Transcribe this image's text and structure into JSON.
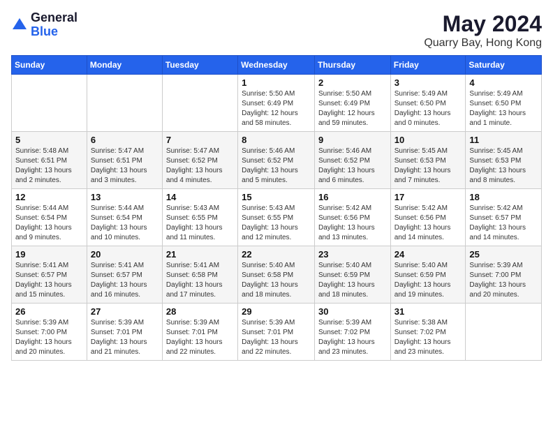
{
  "logo": {
    "general": "General",
    "blue": "Blue"
  },
  "title": "May 2024",
  "subtitle": "Quarry Bay, Hong Kong",
  "days_of_week": [
    "Sunday",
    "Monday",
    "Tuesday",
    "Wednesday",
    "Thursday",
    "Friday",
    "Saturday"
  ],
  "weeks": [
    [
      {
        "day": "",
        "info": ""
      },
      {
        "day": "",
        "info": ""
      },
      {
        "day": "",
        "info": ""
      },
      {
        "day": "1",
        "info": "Sunrise: 5:50 AM\nSunset: 6:49 PM\nDaylight: 12 hours\nand 58 minutes."
      },
      {
        "day": "2",
        "info": "Sunrise: 5:50 AM\nSunset: 6:49 PM\nDaylight: 12 hours\nand 59 minutes."
      },
      {
        "day": "3",
        "info": "Sunrise: 5:49 AM\nSunset: 6:50 PM\nDaylight: 13 hours\nand 0 minutes."
      },
      {
        "day": "4",
        "info": "Sunrise: 5:49 AM\nSunset: 6:50 PM\nDaylight: 13 hours\nand 1 minute."
      }
    ],
    [
      {
        "day": "5",
        "info": "Sunrise: 5:48 AM\nSunset: 6:51 PM\nDaylight: 13 hours\nand 2 minutes."
      },
      {
        "day": "6",
        "info": "Sunrise: 5:47 AM\nSunset: 6:51 PM\nDaylight: 13 hours\nand 3 minutes."
      },
      {
        "day": "7",
        "info": "Sunrise: 5:47 AM\nSunset: 6:52 PM\nDaylight: 13 hours\nand 4 minutes."
      },
      {
        "day": "8",
        "info": "Sunrise: 5:46 AM\nSunset: 6:52 PM\nDaylight: 13 hours\nand 5 minutes."
      },
      {
        "day": "9",
        "info": "Sunrise: 5:46 AM\nSunset: 6:52 PM\nDaylight: 13 hours\nand 6 minutes."
      },
      {
        "day": "10",
        "info": "Sunrise: 5:45 AM\nSunset: 6:53 PM\nDaylight: 13 hours\nand 7 minutes."
      },
      {
        "day": "11",
        "info": "Sunrise: 5:45 AM\nSunset: 6:53 PM\nDaylight: 13 hours\nand 8 minutes."
      }
    ],
    [
      {
        "day": "12",
        "info": "Sunrise: 5:44 AM\nSunset: 6:54 PM\nDaylight: 13 hours\nand 9 minutes."
      },
      {
        "day": "13",
        "info": "Sunrise: 5:44 AM\nSunset: 6:54 PM\nDaylight: 13 hours\nand 10 minutes."
      },
      {
        "day": "14",
        "info": "Sunrise: 5:43 AM\nSunset: 6:55 PM\nDaylight: 13 hours\nand 11 minutes."
      },
      {
        "day": "15",
        "info": "Sunrise: 5:43 AM\nSunset: 6:55 PM\nDaylight: 13 hours\nand 12 minutes."
      },
      {
        "day": "16",
        "info": "Sunrise: 5:42 AM\nSunset: 6:56 PM\nDaylight: 13 hours\nand 13 minutes."
      },
      {
        "day": "17",
        "info": "Sunrise: 5:42 AM\nSunset: 6:56 PM\nDaylight: 13 hours\nand 14 minutes."
      },
      {
        "day": "18",
        "info": "Sunrise: 5:42 AM\nSunset: 6:57 PM\nDaylight: 13 hours\nand 14 minutes."
      }
    ],
    [
      {
        "day": "19",
        "info": "Sunrise: 5:41 AM\nSunset: 6:57 PM\nDaylight: 13 hours\nand 15 minutes."
      },
      {
        "day": "20",
        "info": "Sunrise: 5:41 AM\nSunset: 6:57 PM\nDaylight: 13 hours\nand 16 minutes."
      },
      {
        "day": "21",
        "info": "Sunrise: 5:41 AM\nSunset: 6:58 PM\nDaylight: 13 hours\nand 17 minutes."
      },
      {
        "day": "22",
        "info": "Sunrise: 5:40 AM\nSunset: 6:58 PM\nDaylight: 13 hours\nand 18 minutes."
      },
      {
        "day": "23",
        "info": "Sunrise: 5:40 AM\nSunset: 6:59 PM\nDaylight: 13 hours\nand 18 minutes."
      },
      {
        "day": "24",
        "info": "Sunrise: 5:40 AM\nSunset: 6:59 PM\nDaylight: 13 hours\nand 19 minutes."
      },
      {
        "day": "25",
        "info": "Sunrise: 5:39 AM\nSunset: 7:00 PM\nDaylight: 13 hours\nand 20 minutes."
      }
    ],
    [
      {
        "day": "26",
        "info": "Sunrise: 5:39 AM\nSunset: 7:00 PM\nDaylight: 13 hours\nand 20 minutes."
      },
      {
        "day": "27",
        "info": "Sunrise: 5:39 AM\nSunset: 7:01 PM\nDaylight: 13 hours\nand 21 minutes."
      },
      {
        "day": "28",
        "info": "Sunrise: 5:39 AM\nSunset: 7:01 PM\nDaylight: 13 hours\nand 22 minutes."
      },
      {
        "day": "29",
        "info": "Sunrise: 5:39 AM\nSunset: 7:01 PM\nDaylight: 13 hours\nand 22 minutes."
      },
      {
        "day": "30",
        "info": "Sunrise: 5:39 AM\nSunset: 7:02 PM\nDaylight: 13 hours\nand 23 minutes."
      },
      {
        "day": "31",
        "info": "Sunrise: 5:38 AM\nSunset: 7:02 PM\nDaylight: 13 hours\nand 23 minutes."
      },
      {
        "day": "",
        "info": ""
      }
    ]
  ]
}
